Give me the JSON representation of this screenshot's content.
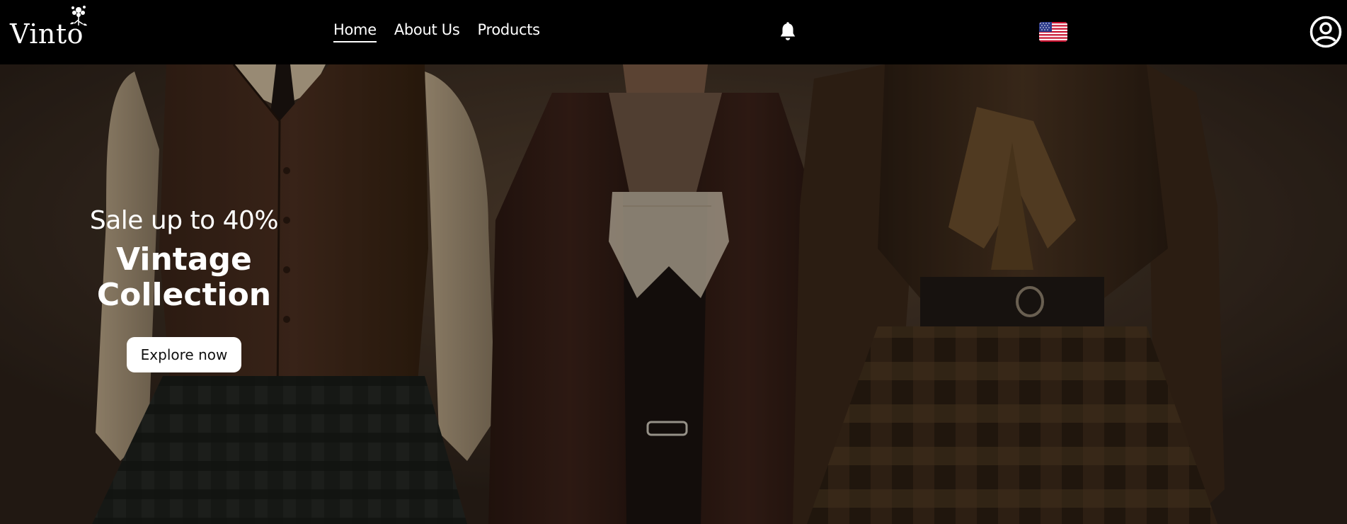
{
  "brand": {
    "logo_text": "Vinto",
    "logo_icon": "flower-icon"
  },
  "nav": {
    "links": [
      {
        "label": "Home",
        "active": true
      },
      {
        "label": "About Us",
        "active": false
      },
      {
        "label": "Products",
        "active": false
      }
    ],
    "notification_icon": "bell-icon",
    "language_icon": "us-flag-icon",
    "account_icon": "user-circle-icon"
  },
  "hero": {
    "subtitle": "Sale up to 40%",
    "title_line1": "Vintage",
    "title_line2": "Collection",
    "cta_label": "Explore now"
  },
  "colors": {
    "nav_bg": "#000000",
    "text": "#ffffff",
    "button_bg": "#ffffff",
    "button_text": "#111111"
  }
}
